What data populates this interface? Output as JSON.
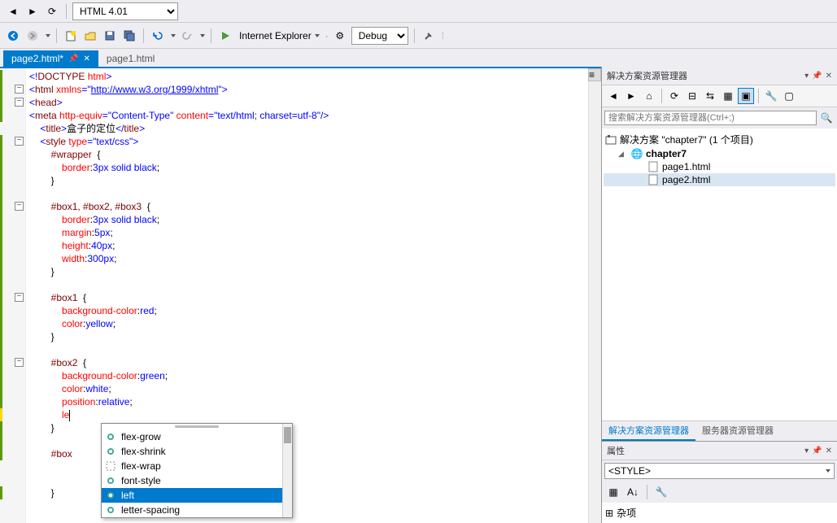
{
  "toolbar1": {
    "doctype_select": "HTML 4.01"
  },
  "toolbar2": {
    "browser_label": "Internet Explorer",
    "config_label": "Debug"
  },
  "tabs": [
    {
      "label": "page2.html*",
      "active": true
    },
    {
      "label": "page1.html",
      "active": false
    }
  ],
  "code_lines": [
    {
      "t": "<!DOCTYPE html>",
      "fold": "",
      "bar": "g"
    },
    {
      "t": "<html xmlns=\"http://www.w3.org/1999/xhtml\">",
      "fold": "-",
      "bar": "g",
      "link": "http://www.w3.org/1999/xhtml"
    },
    {
      "t": "<head>",
      "fold": "-",
      "bar": "g"
    },
    {
      "t": "<meta http-equiv=\"Content-Type\" content=\"text/html; charset=utf-8\"/>",
      "bar": "g"
    },
    {
      "t": "    <title>盒子的定位</title>",
      "bar": ""
    },
    {
      "t": "    <style type=\"text/css\">",
      "fold": "-",
      "bar": "g"
    },
    {
      "t": "        #wrapper {",
      "bar": "g"
    },
    {
      "t": "            border:3px solid black;",
      "bar": "g"
    },
    {
      "t": "        }",
      "bar": "g"
    },
    {
      "t": "",
      "bar": "g"
    },
    {
      "t": "        #box1, #box2, #box3 {",
      "fold": "-",
      "bar": "g"
    },
    {
      "t": "            border:3px solid black;",
      "bar": "g"
    },
    {
      "t": "            margin:5px;",
      "bar": "g"
    },
    {
      "t": "            height:40px;",
      "bar": "g"
    },
    {
      "t": "            width:300px;",
      "bar": "g"
    },
    {
      "t": "        }",
      "bar": "g"
    },
    {
      "t": "",
      "bar": "g"
    },
    {
      "t": "        #box1 {",
      "fold": "-",
      "bar": "g"
    },
    {
      "t": "            background-color:red;",
      "bar": "g"
    },
    {
      "t": "            color:yellow;",
      "bar": "g"
    },
    {
      "t": "        }",
      "bar": "g"
    },
    {
      "t": "",
      "bar": "g"
    },
    {
      "t": "        #box2 {",
      "fold": "-",
      "bar": "g"
    },
    {
      "t": "            background-color:green;",
      "bar": "g"
    },
    {
      "t": "            color:white;",
      "bar": "g"
    },
    {
      "t": "            position:relative;",
      "bar": "g"
    },
    {
      "t": "            le",
      "bar": "y"
    },
    {
      "t": "        }",
      "bar": "g"
    },
    {
      "t": "",
      "bar": "g"
    },
    {
      "t": "        #box",
      "bar": "g"
    },
    {
      "t": "",
      "bar": ""
    },
    {
      "t": "",
      "bar": ""
    },
    {
      "t": "        }",
      "bar": "g"
    }
  ],
  "intellisense": {
    "items": [
      {
        "label": "flex-grow",
        "icon": "prop"
      },
      {
        "label": "flex-shrink",
        "icon": "prop"
      },
      {
        "label": "flex-wrap",
        "icon": "snip"
      },
      {
        "label": "font-style",
        "icon": "prop"
      },
      {
        "label": "left",
        "icon": "prop",
        "selected": true
      },
      {
        "label": "letter-spacing",
        "icon": "prop"
      }
    ]
  },
  "solution_explorer": {
    "title": "解决方案资源管理器",
    "search_placeholder": "搜索解决方案资源管理器(Ctrl+;)",
    "solution_label": "解决方案 \"chapter7\" (1 个项目)",
    "project": "chapter7",
    "files": [
      "page1.html",
      "page2.html"
    ],
    "tab_solution": "解决方案资源管理器",
    "tab_server": "服务器资源管理器"
  },
  "properties": {
    "title": "属性",
    "selector_label": "<STYLE>",
    "category": "杂项"
  }
}
